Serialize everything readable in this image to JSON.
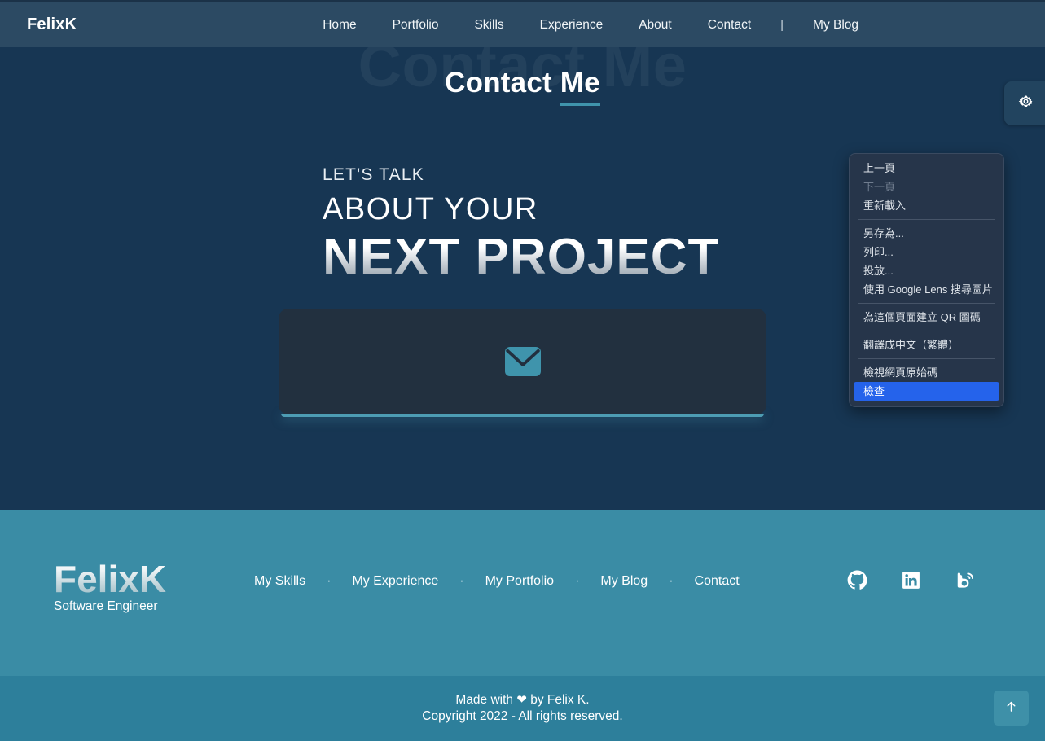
{
  "header": {
    "brand": "FelixK",
    "nav": [
      {
        "label": "Home"
      },
      {
        "label": "Portfolio"
      },
      {
        "label": "Skills"
      },
      {
        "label": "Experience"
      },
      {
        "label": "About"
      },
      {
        "label": "Contact"
      }
    ],
    "separator": "|",
    "blog_label": "My Blog",
    "gear_icon": "gear-icon"
  },
  "hero": {
    "ghost_title": "Contact Me",
    "title_part1": "Contact ",
    "title_part2": "Me",
    "lets_talk": "LET'S TALK",
    "about_your": "ABOUT YOUR",
    "next_project": "NEXT PROJECT",
    "card_icon": "envelope-icon"
  },
  "footer": {
    "logo": "FelixK",
    "subtitle": "Software Engineer",
    "nav": [
      {
        "label": "My Skills"
      },
      {
        "label": "My Experience"
      },
      {
        "label": "My Portfolio"
      },
      {
        "label": "My Blog"
      },
      {
        "label": "Contact"
      }
    ],
    "dot": "·",
    "socials": [
      {
        "name": "github-icon"
      },
      {
        "name": "linkedin-icon"
      },
      {
        "name": "blog-icon"
      }
    ],
    "made_with_pre": "Made with ",
    "heart": "❤",
    "made_with_post": " by Felix K.",
    "copyright": "Copyright 2022 - All rights reserved.",
    "to_top_icon": "arrow-up-icon"
  },
  "context_menu": {
    "items": [
      {
        "label": "上一頁",
        "state": "normal"
      },
      {
        "label": "下一頁",
        "state": "disabled"
      },
      {
        "label": "重新載入",
        "state": "normal"
      },
      {
        "separator": true
      },
      {
        "label": "另存為...",
        "state": "normal"
      },
      {
        "label": "列印...",
        "state": "normal"
      },
      {
        "label": "投放...",
        "state": "normal"
      },
      {
        "label": "使用 Google Lens 搜尋圖片",
        "state": "normal"
      },
      {
        "separator": true
      },
      {
        "label": "為這個頁面建立 QR 圖碼",
        "state": "normal"
      },
      {
        "separator": true
      },
      {
        "label": "翻譯成中文（繁體）",
        "state": "normal"
      },
      {
        "separator": true
      },
      {
        "label": "檢視網頁原始碼",
        "state": "normal"
      },
      {
        "label": "檢查",
        "state": "selected"
      }
    ]
  },
  "colors": {
    "page_bg": "#173653",
    "header_bg": "#2c4a63",
    "footer_bg": "#3a8ca5",
    "copyright_bg": "#2d7f9b",
    "accent_teal": "#3f94ac",
    "card_bg": "#22303f",
    "menu_bg": "#26354a",
    "menu_highlight": "#2563eb"
  }
}
